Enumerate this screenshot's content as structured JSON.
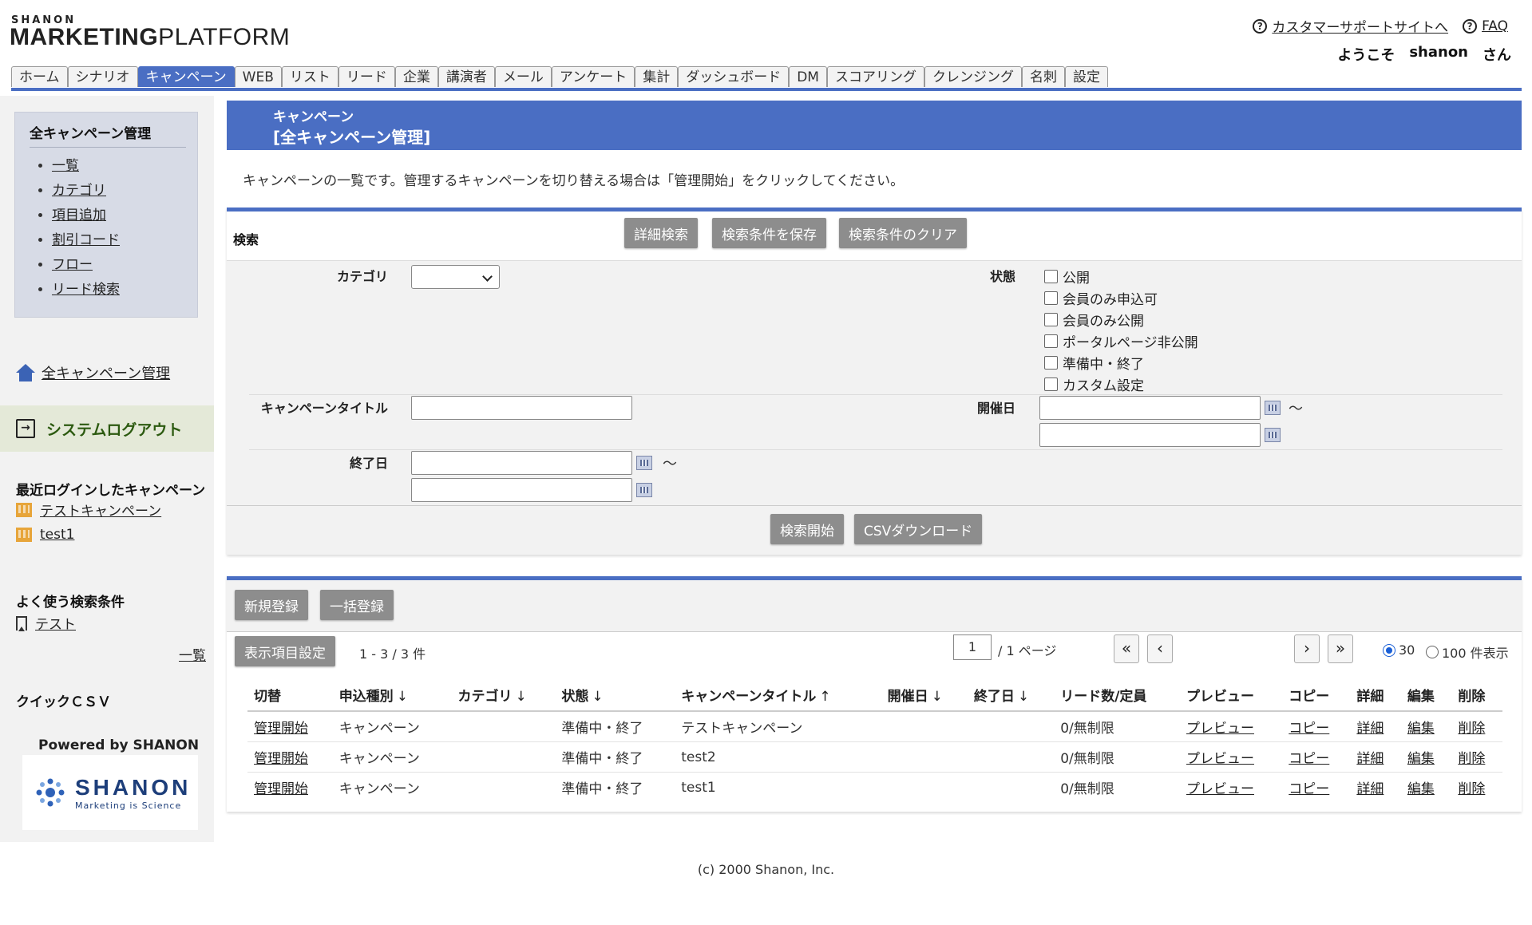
{
  "header": {
    "logo_small": "SHANON",
    "logo_marketing": "MARKETING",
    "logo_platform": "PLATFORM",
    "support_link": "カスタマーサポートサイトへ",
    "faq_link": "FAQ",
    "welcome": "ようこそ",
    "username": "shanon",
    "honorific": "さん"
  },
  "tabs": [
    "ホーム",
    "シナリオ",
    "キャンペーン",
    "WEB",
    "リスト",
    "リード",
    "企業",
    "講演者",
    "メール",
    "アンケート",
    "集計",
    "ダッシュボード",
    "DM",
    "スコアリング",
    "クレンジング",
    "名刺",
    "設定"
  ],
  "active_tab": "キャンペーン",
  "sidebar": {
    "box_title": "全キャンペーン管理",
    "menu": [
      "一覧",
      "カテゴリ",
      "項目追加",
      "割引コード",
      "フロー",
      "リード検索"
    ],
    "home_link": "全キャンペーン管理",
    "logout": "システムログアウト",
    "recent_title": "最近ログインしたキャンペーン",
    "recent": [
      "テストキャンペーン",
      "test1"
    ],
    "fav_title": "よく使う検索条件",
    "fav": [
      "テスト"
    ],
    "fav_more": "一覧",
    "quick_csv": "クイックＣＳＶ",
    "powered": "Powered by SHANON",
    "brand": "SHANON",
    "brand_sub": "Marketing is Science"
  },
  "page": {
    "section": "キャンペーン",
    "title": "[全キャンペーン管理]",
    "description": "キャンペーンの一覧です。管理するキャンペーンを切り替える場合は「管理開始」をクリックしてください。"
  },
  "search": {
    "label": "検索",
    "btn_detail": "詳細検索",
    "btn_save": "検索条件を保存",
    "btn_clear": "検索条件のクリア",
    "category_label": "カテゴリ",
    "category_value": "",
    "status_label": "状態",
    "status_options": [
      "公開",
      "会員のみ申込可",
      "会員のみ公開",
      "ポータルページ非公開",
      "準備中・終了",
      "カスタム設定"
    ],
    "title_label": "キャンペーンタイトル",
    "date_label": "開催日",
    "end_label": "終了日",
    "tilde": "～",
    "btn_search": "検索開始",
    "btn_csv": "CSVダウンロード"
  },
  "list": {
    "btn_new": "新規登録",
    "btn_bulk": "一括登録",
    "btn_display": "表示項目設定",
    "count": "1 - 3 / 3 件",
    "page_current": "1",
    "page_total": "/ 1 ページ",
    "per_page_30": "30",
    "per_page_100": "100 件表示",
    "nav": [
      "«",
      "‹",
      "›",
      "»"
    ],
    "columns": [
      "切替",
      "申込種別",
      "カテゴリ",
      "状態",
      "キャンペーンタイトル",
      "開催日",
      "終了日",
      "リード数/定員",
      "プレビュー",
      "コピー",
      "詳細",
      "編集",
      "削除"
    ],
    "sort_down": "↓",
    "sort_up": "↑",
    "rows": [
      {
        "switch": "管理開始",
        "type": "キャンペーン",
        "category": "",
        "status": "準備中・終了",
        "title": "テストキャンペーン",
        "date": "",
        "end": "",
        "leads": "0/無制限",
        "preview": "プレビュー",
        "copy": "コピー",
        "detail": "詳細",
        "edit": "編集",
        "delete": "削除"
      },
      {
        "switch": "管理開始",
        "type": "キャンペーン",
        "category": "",
        "status": "準備中・終了",
        "title": "test2",
        "date": "",
        "end": "",
        "leads": "0/無制限",
        "preview": "プレビュー",
        "copy": "コピー",
        "detail": "詳細",
        "edit": "編集",
        "delete": "削除"
      },
      {
        "switch": "管理開始",
        "type": "キャンペーン",
        "category": "",
        "status": "準備中・終了",
        "title": "test1",
        "date": "",
        "end": "",
        "leads": "0/無制限",
        "preview": "プレビュー",
        "copy": "コピー",
        "detail": "詳細",
        "edit": "編集",
        "delete": "削除"
      }
    ]
  },
  "footer": "(c) 2000 Shanon, Inc.",
  "colors": {
    "accent": "#4a6ec3",
    "button": "#8d8d8d",
    "logout_bg": "#e4e9d8"
  }
}
